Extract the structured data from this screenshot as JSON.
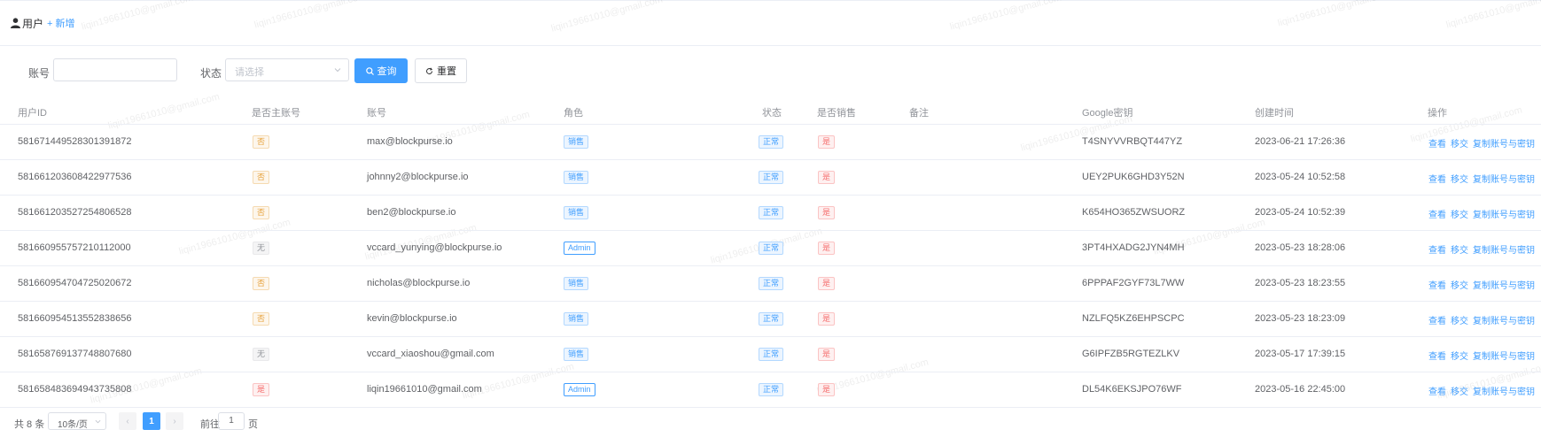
{
  "header": {
    "title": "用户",
    "add_label": "新增"
  },
  "filters": {
    "account_label": "账号",
    "status_label": "状态",
    "status_placeholder": "请选择",
    "search_label": "查询",
    "reset_label": "重置"
  },
  "columns": [
    "用户ID",
    "是否主账号",
    "账号",
    "角色",
    "状态",
    "是否销售",
    "备注",
    "Google密钥",
    "创建时间",
    "操作"
  ],
  "rows": [
    {
      "id": "581671449528301391872",
      "main": "否",
      "main_color": "orange",
      "account": "max@blockpurse.io",
      "role": "销售",
      "role_style": "blue",
      "status": "正常",
      "sales": "是",
      "note": "",
      "key": "T4SNYVVRBQT447YZ",
      "created": "2023-06-21 17:26:36"
    },
    {
      "id": "581661203608422977536",
      "main": "否",
      "main_color": "orange",
      "account": "johnny2@blockpurse.io",
      "role": "销售",
      "role_style": "blue",
      "status": "正常",
      "sales": "是",
      "note": "",
      "key": "UEY2PUK6GHD3Y52N",
      "created": "2023-05-24 10:52:58"
    },
    {
      "id": "581661203527254806528",
      "main": "否",
      "main_color": "orange",
      "account": "ben2@blockpurse.io",
      "role": "销售",
      "role_style": "blue",
      "status": "正常",
      "sales": "是",
      "note": "",
      "key": "K654HO365ZWSUORZ",
      "created": "2023-05-24 10:52:39"
    },
    {
      "id": "581660955757210112000",
      "main": "无",
      "main_color": "gray",
      "account": "vccard_yunying@blockpurse.io",
      "role": "Admin",
      "role_style": "blue-plain",
      "status": "正常",
      "sales": "是",
      "note": "",
      "key": "3PT4HXADG2JYN4MH",
      "created": "2023-05-23 18:28:06"
    },
    {
      "id": "581660954704725020672",
      "main": "否",
      "main_color": "orange",
      "account": "nicholas@blockpurse.io",
      "role": "销售",
      "role_style": "blue",
      "status": "正常",
      "sales": "是",
      "note": "",
      "key": "6PPPAF2GYF73L7WW",
      "created": "2023-05-23 18:23:55"
    },
    {
      "id": "581660954513552838656",
      "main": "否",
      "main_color": "orange",
      "account": "kevin@blockpurse.io",
      "role": "销售",
      "role_style": "blue",
      "status": "正常",
      "sales": "是",
      "note": "",
      "key": "NZLFQ5KZ6EHPSCPC",
      "created": "2023-05-23 18:23:09"
    },
    {
      "id": "581658769137748807680",
      "main": "无",
      "main_color": "gray",
      "account": "vccard_xiaoshou@gmail.com",
      "role": "销售",
      "role_style": "blue",
      "status": "正常",
      "sales": "是",
      "note": "",
      "key": "G6IPFZB5RGTEZLKV",
      "created": "2023-05-17 17:39:15"
    },
    {
      "id": "581658483694943735808",
      "main": "是",
      "main_color": "red",
      "account": "liqin19661010@gmail.com",
      "role": "Admin",
      "role_style": "blue-plain",
      "status": "正常",
      "sales": "是",
      "note": "",
      "key": "DL54K6EKSJPO76WF",
      "created": "2023-05-16 22:45:00"
    }
  ],
  "row_actions": [
    "查看",
    "移交",
    "复制账号与密钥"
  ],
  "pagination": {
    "total": "共 8 条",
    "page_size": "10条/页",
    "current_page": "1",
    "goto_prefix": "前往",
    "goto_value": "1",
    "goto_suffix": "页"
  },
  "watermark_text": "liqin19661010@gmail.com",
  "colors": {
    "primary": "#409eff",
    "border": "#ebeef5"
  },
  "icons": {
    "user": "user-icon",
    "add": "plus-icon",
    "search": "search-icon",
    "reset": "refresh-icon",
    "select_arrow": "chevron-down-icon",
    "prev": "chevron-left-icon",
    "next": "chevron-right-icon"
  }
}
